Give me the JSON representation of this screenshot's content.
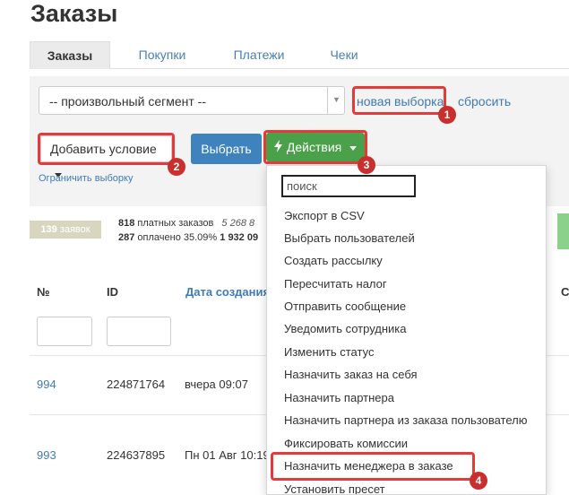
{
  "page_title": "Заказы",
  "tabs": [
    {
      "label": "Заказы",
      "active": true
    },
    {
      "label": "Покупки",
      "active": false
    },
    {
      "label": "Платежи",
      "active": false
    },
    {
      "label": "Чеки",
      "active": false
    }
  ],
  "filter": {
    "segment_value": "-- произвольный сегмент --",
    "new_selection_label": "новая выборка",
    "reset_label": "сбросить",
    "add_condition_label": "Добавить условие",
    "select_label": "Выбрать",
    "actions_label": "Действия",
    "limit_label": "Ограничить выборку"
  },
  "stats": {
    "orders_count": "139",
    "orders_word": "заявок",
    "paid_orders_count": "818",
    "paid_orders_label": "платных заказов",
    "paid_orders_sum": "5 268 8",
    "paid_count": "287",
    "paid_label": "оплачено 35.09%",
    "paid_sum": "1 932 09"
  },
  "table": {
    "columns": [
      "№",
      "ID",
      "Дата создания",
      "С"
    ],
    "rows": [
      {
        "num": "994",
        "id": "224871764",
        "date": "вчера 09:07"
      },
      {
        "num": "993",
        "id": "224637895",
        "date": "Пн 01 Авг 10:19"
      }
    ]
  },
  "actions_menu": {
    "search_placeholder": "поиск",
    "items": [
      "Экспорт в CSV",
      "Выбрать пользователей",
      "Создать рассылку",
      "Пересчитать налог",
      "Отправить сообщение",
      "Уведомить сотрудника",
      "Изменить статус",
      "Назначить заказ на себя",
      "Назначить партнера",
      "Назначить партнера из заказа пользователю",
      "Фиксировать комиссии",
      "Назначить менеджера в заказе",
      "Установить пресет"
    ]
  },
  "callouts": [
    "1",
    "2",
    "3",
    "4"
  ],
  "colors": {
    "link": "#3f7bb5",
    "primary_button": "#3e82be",
    "actions_button": "#4aa14a",
    "highlight": "#e43a3a",
    "callout_badge": "#c8302e"
  },
  "icons": [
    "chevron-down-icon",
    "lightning-icon",
    "caret-down-icon"
  ]
}
